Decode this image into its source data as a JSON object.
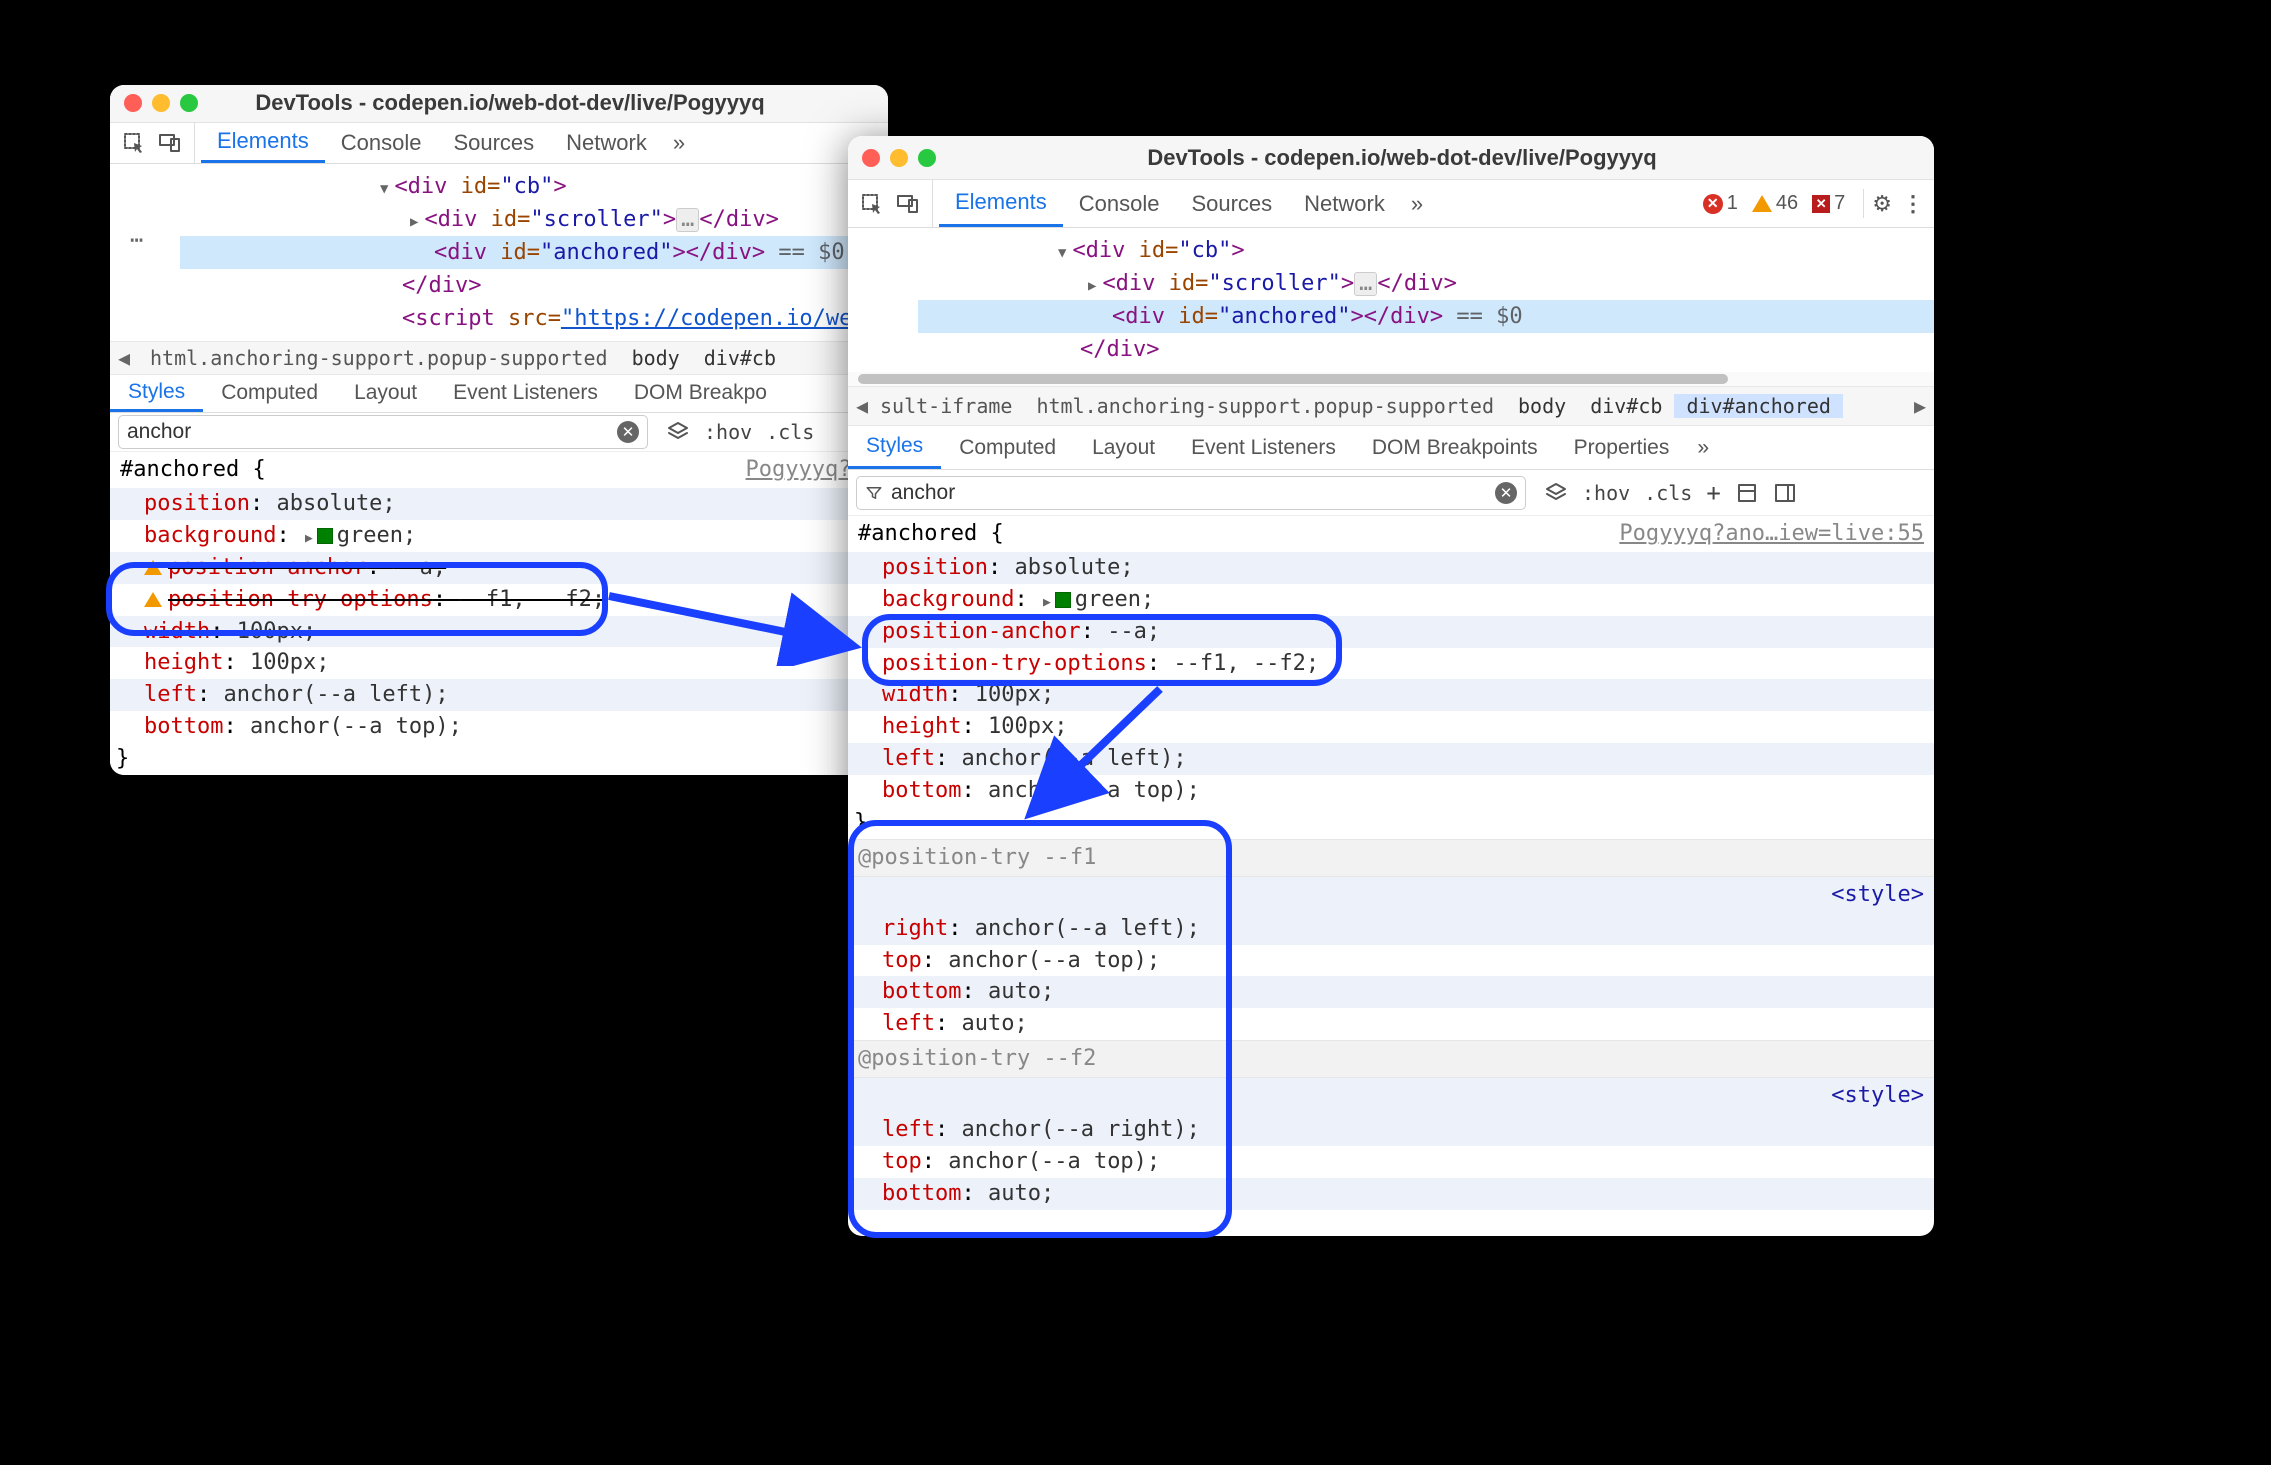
{
  "windows": {
    "left": {
      "title": "DevTools - codepen.io/web-dot-dev/live/Pogyyyq",
      "tabs": [
        "Elements",
        "Console",
        "Sources",
        "Network"
      ],
      "active_tab": "Elements",
      "more": "»",
      "dom": {
        "line0": {
          "open": "<div",
          "attr": "id=",
          "val": "\"cb\"",
          "close": ">"
        },
        "line1": {
          "open": "<div",
          "attr": "id=",
          "val": "\"scroller\"",
          "close": ">",
          "pill": "…",
          "closeTag": "</div>"
        },
        "line2": {
          "open": "<div",
          "attr": "id=",
          "val": "\"anchored\"",
          "close": ">",
          "closeTag": "</div>",
          "eq": "== $0"
        },
        "line3": {
          "closeTag": "</div>"
        },
        "line4": {
          "open": "<script",
          "attr": "src=",
          "link": "\"https://codepen.io/web-dot-d"
        }
      },
      "crumbs": [
        "html.anchoring-support.popup-supported",
        "body",
        "div#cb"
      ],
      "sub_tabs": [
        "Styles",
        "Computed",
        "Layout",
        "Event Listeners",
        "DOM Breakpo"
      ],
      "active_sub_tab": "Styles",
      "filter_value": "anchor",
      "filter_actions": {
        "hov": ":hov",
        "cls": ".cls"
      },
      "rule": {
        "selector": "#anchored {",
        "src": "Pogyyyq?an",
        "decls": [
          {
            "prop": "position",
            "val": "absolute;",
            "even": true
          },
          {
            "prop": "background",
            "val": "green;",
            "swatch": true,
            "caret": true
          },
          {
            "invalid": true,
            "strike": true,
            "prop": "position-anchor",
            "val": "--a;",
            "even": true
          },
          {
            "invalid": true,
            "strike": true,
            "prop": "position-try-options",
            "val": "--f1, --f2;"
          },
          {
            "prop": "width",
            "val": "100px;",
            "even": true
          },
          {
            "prop": "height",
            "val": "100px;"
          },
          {
            "prop": "left",
            "val": "anchor(--a left);",
            "even": true
          },
          {
            "prop": "bottom",
            "val": "anchor(--a top);"
          }
        ],
        "close": "}"
      }
    },
    "right": {
      "title": "DevTools - codepen.io/web-dot-dev/live/Pogyyyq",
      "tabs": [
        "Elements",
        "Console",
        "Sources",
        "Network"
      ],
      "active_tab": "Elements",
      "more": "»",
      "status": {
        "errors": "1",
        "warnings": "46",
        "blocked": "7"
      },
      "dom": {
        "line0": {
          "open": "<div",
          "attr": "id=",
          "val": "\"cb\"",
          "close": ">"
        },
        "line1": {
          "open": "<div",
          "attr": "id=",
          "val": "\"scroller\"",
          "close": ">",
          "pill": "…",
          "closeTag": "</div>"
        },
        "line2": {
          "open": "<div",
          "attr": "id=",
          "val": "\"anchored\"",
          "close": ">",
          "closeTag": "</div>",
          "eq": "== $0"
        },
        "line3": {
          "closeTag": "</div>"
        }
      },
      "crumbs_prefix": "sult-iframe",
      "crumbs": [
        "html.anchoring-support.popup-supported",
        "body",
        "div#cb",
        "div#anchored"
      ],
      "sub_tabs": [
        "Styles",
        "Computed",
        "Layout",
        "Event Listeners",
        "DOM Breakpoints",
        "Properties"
      ],
      "active_sub_tab": "Styles",
      "filter_value": "anchor",
      "filter_actions": {
        "hov": ":hov",
        "cls": ".cls"
      },
      "rule": {
        "selector": "#anchored {",
        "src": "Pogyyyq?ano…iew=live:55",
        "decls": [
          {
            "prop": "position",
            "val": "absolute;",
            "even": true
          },
          {
            "prop": "background",
            "val": "green;",
            "swatch": true,
            "caret": true
          },
          {
            "prop": "position-anchor",
            "val": "--a;",
            "even": true
          },
          {
            "prop": "position-try-options",
            "val": "--f1, --f2;"
          },
          {
            "prop": "width",
            "val": "100px;",
            "even": true
          },
          {
            "prop": "height",
            "val": "100px;"
          },
          {
            "prop": "left",
            "val": "anchor(--a left);",
            "even": true
          },
          {
            "prop": "bottom",
            "val": "anchor(--a top);"
          }
        ],
        "close": "}"
      },
      "pt1": {
        "header": "@position-try --f1",
        "style_lnk": "<style>",
        "decls": [
          {
            "prop": "right",
            "val": "anchor(--a left);",
            "even": true
          },
          {
            "prop": "top",
            "val": "anchor(--a top);"
          },
          {
            "prop": "bottom",
            "val": "auto;",
            "even": true
          },
          {
            "prop": "left",
            "val": "auto;"
          }
        ]
      },
      "pt2": {
        "header": "@position-try --f2",
        "style_lnk": "<style>",
        "decls": [
          {
            "prop": "left",
            "val": "anchor(--a right);",
            "even": true
          },
          {
            "prop": "top",
            "val": "anchor(--a top);"
          },
          {
            "prop": "bottom",
            "val": "auto;",
            "even": true
          }
        ]
      }
    }
  },
  "colors": {
    "highlight": "#1a3fff"
  }
}
